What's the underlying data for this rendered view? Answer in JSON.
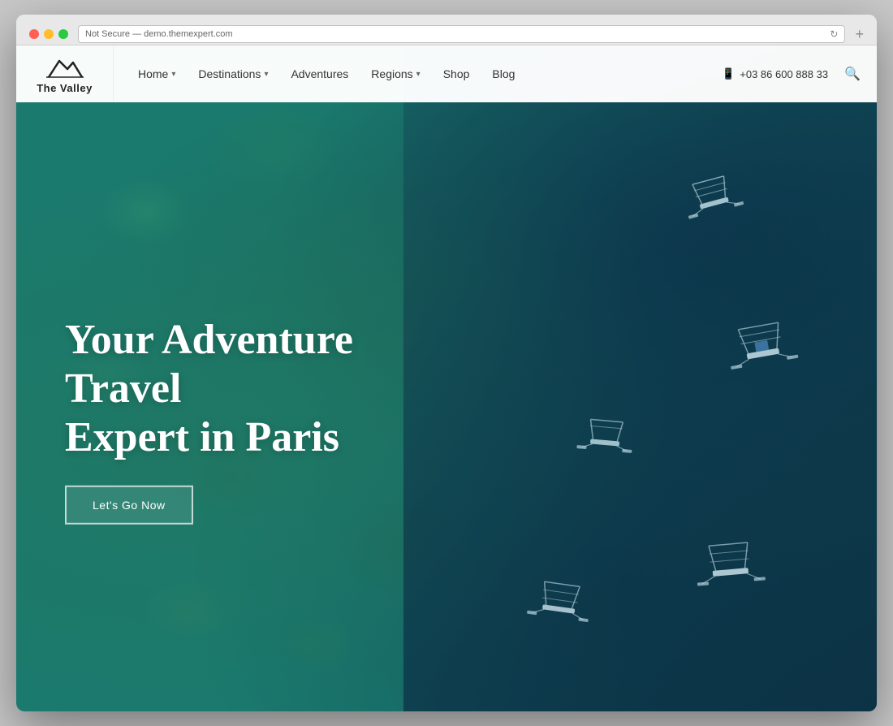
{
  "browser": {
    "address": "Not Secure — demo.themexpert.com",
    "new_tab_label": "+"
  },
  "logo": {
    "name": "The Valley",
    "tagline": "The Valley"
  },
  "nav": {
    "items": [
      {
        "label": "Home",
        "has_dropdown": true
      },
      {
        "label": "Destinations",
        "has_dropdown": true
      },
      {
        "label": "Adventures",
        "has_dropdown": false
      },
      {
        "label": "Regions",
        "has_dropdown": true
      },
      {
        "label": "Shop",
        "has_dropdown": false
      },
      {
        "label": "Blog",
        "has_dropdown": false
      }
    ],
    "phone_icon": "📱",
    "phone": "+03 86 600 888 33"
  },
  "hero": {
    "title_line1": "Your Adventure Travel",
    "title_line2": "Expert in Paris",
    "cta_label": "Let's Go Now"
  }
}
